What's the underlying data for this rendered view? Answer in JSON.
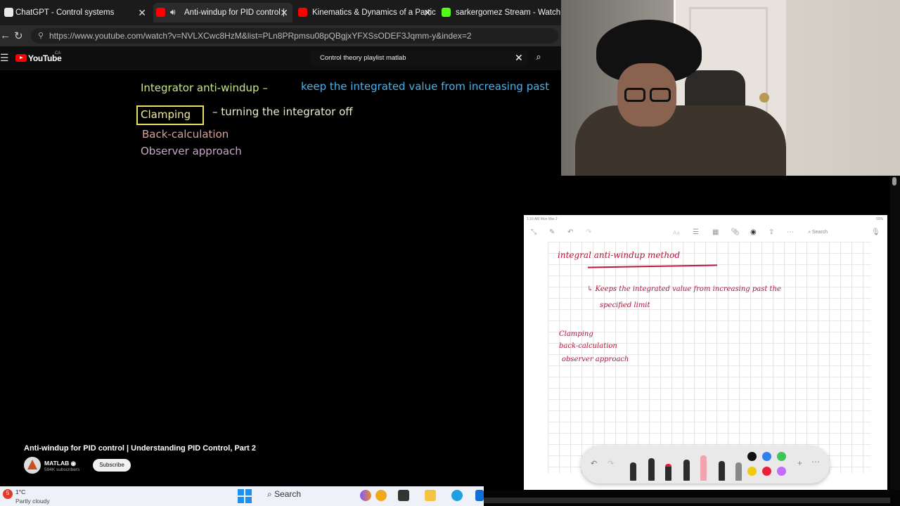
{
  "browser": {
    "tabs": [
      {
        "title": "ChatGPT - Control systems",
        "active": false
      },
      {
        "title": "Anti-windup for PID control |",
        "active": true
      },
      {
        "title": "Kinematics & Dynamics of a Partic",
        "active": false
      },
      {
        "title": "sarkergomez Stream - Watch Live",
        "active": false
      }
    ],
    "url": "https://www.youtube.com/watch?v=NVLXCwc8HzM&list=PLn8PRpmsu08pQBgjxYFXSsODEF3Jqmm-y&index=2"
  },
  "youtube": {
    "logo_text": "YouTube",
    "country_code": "CA",
    "search_value": "Control theory playlist matlab"
  },
  "video": {
    "line1a": "Integrator anti-windup –",
    "line1b": "keep the integrated value from increasing past",
    "line2a": "Clamping",
    "line2b": "– turning the integrator off",
    "line3": "Back-calculation",
    "line4": "Observer approach",
    "title": "Anti-windup for PID control | Understanding PID Control, Part 2",
    "channel": "MATLAB ◉",
    "subscribers": "594K subscribers",
    "subscribe_label": "Subscribe"
  },
  "notes": {
    "status_left": "1:16 AM  Mon Mar 2",
    "status_right": "55%",
    "search_label": "Search",
    "text_size_label": "Aa",
    "heading": "integral    anti-windup method",
    "line1": "↳ Keeps the integrated value from increasing past the",
    "line2": "specified limit",
    "list": [
      "Clamping",
      "back-calculation",
      "observer approach"
    ]
  },
  "pen_colors": [
    "#111111",
    "#2f80ed",
    "#3ec457",
    "#f2c811",
    "#e8203c",
    "#c46bff"
  ],
  "taskbar": {
    "weather_badge": "5",
    "temperature": "1°C",
    "condition": "Partly cloudy",
    "search_label": "Search"
  }
}
